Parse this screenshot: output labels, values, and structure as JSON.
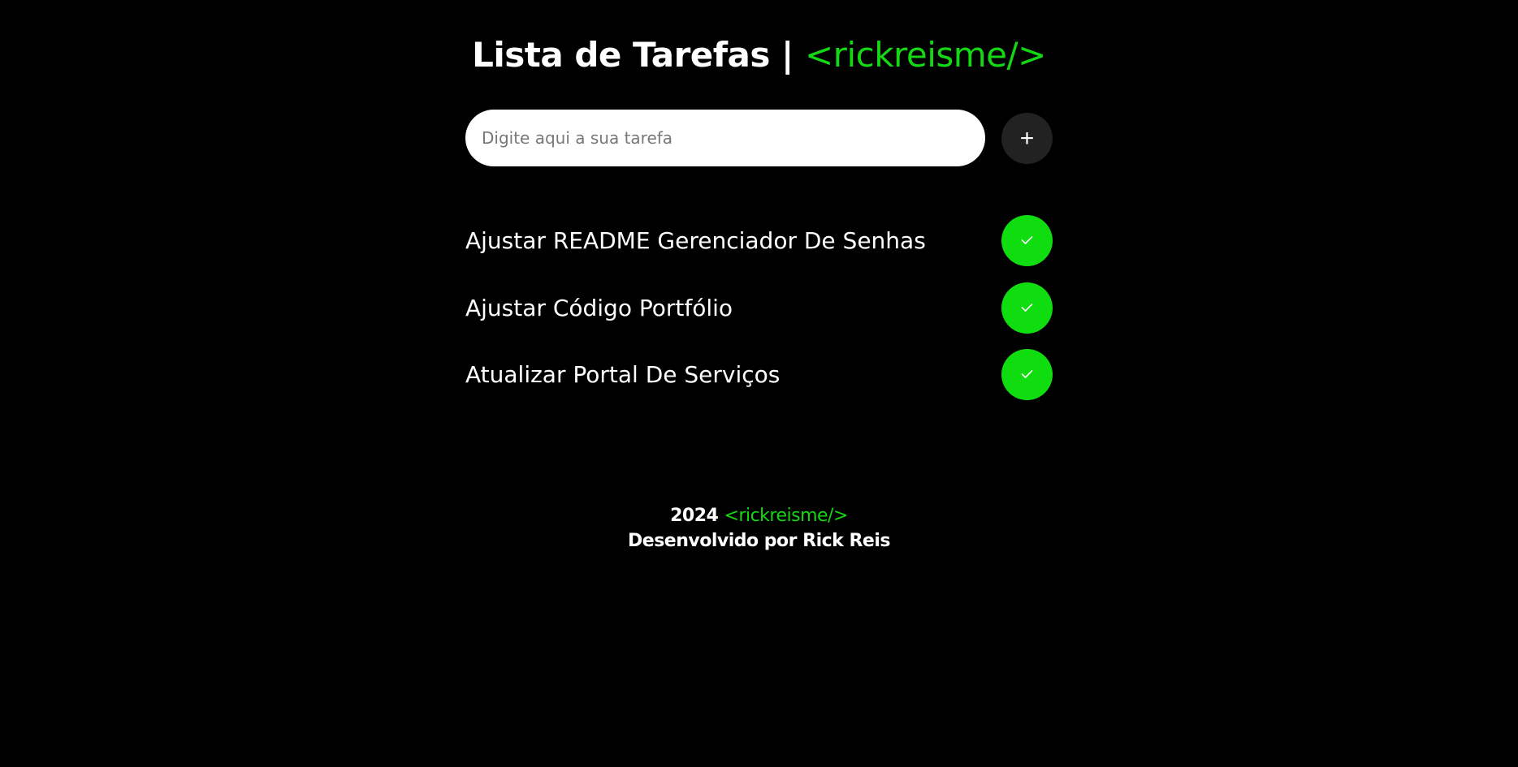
{
  "header": {
    "title": "Lista de Tarefas |",
    "brand": "<rickreisme/>"
  },
  "input": {
    "placeholder": "Digite aqui a sua tarefa",
    "add_label": "+"
  },
  "tasks": [
    {
      "label": "Ajustar README Gerenciador De Senhas"
    },
    {
      "label": "Ajustar Código Portfólio"
    },
    {
      "label": "Atualizar Portal De Serviços"
    }
  ],
  "footer": {
    "year": "2024",
    "brand": "<rickreisme/>",
    "credit": "Desenvolvido por Rick Reis"
  },
  "colors": {
    "accent": "#10dd10",
    "background": "#000000",
    "button_dark": "#222222"
  },
  "icons": {
    "add": "plus-icon",
    "done": "check-icon"
  }
}
